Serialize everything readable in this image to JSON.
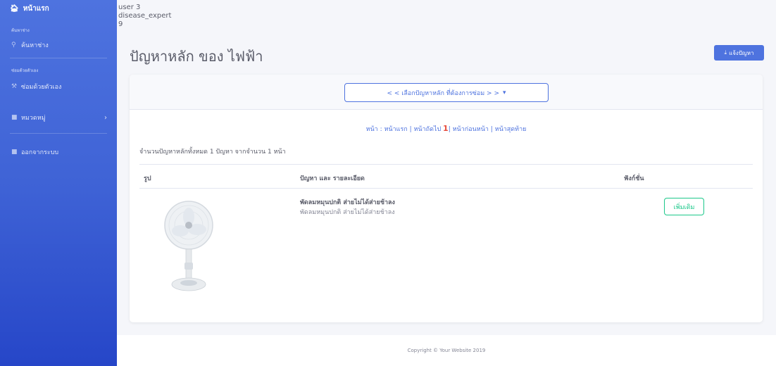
{
  "sidebar": {
    "brand": {
      "icon": "home-icon",
      "label": "หน้าแรก"
    },
    "section_search": "ค้นหาช่าง",
    "search_item": {
      "icon": "search-icon",
      "label": "ค้นหาช่าง"
    },
    "section_self_repair": "ซ่อมด้วยตัวเอง",
    "self_repair_item": {
      "icon": "wrench-icon",
      "label": "ซ่อมด้วยตัวเอง"
    },
    "category_item": {
      "icon": "folder-icon",
      "label": "หมวดหมู่",
      "chevron": "›"
    },
    "logout_item": {
      "icon": "folder-icon",
      "label": "ออกจากระบบ"
    }
  },
  "user": {
    "name": "user 3",
    "role": "disease_expert",
    "id": "9"
  },
  "page": {
    "title": "ปัญหาหลัก ของ ไฟฟ้า"
  },
  "report_button": {
    "icon": "download-icon",
    "label": "แจ้งปัญหา"
  },
  "selector": {
    "label": "< < เลือกปัญหาหลัก ที่ต้องการซ่อม > >",
    "caret": "▾"
  },
  "pager": {
    "prefix": "หน้า :",
    "first": "หน้าแรก",
    "next": "หน้าถัดไป",
    "current": "1",
    "prev": "หน้าก่อนหน้า",
    "last": "หน้าสุดท้าย"
  },
  "summary": "จำนวนปัญหาหลักทั้งหมด 1 ปัญหา จากจำนวน 1 หน้า",
  "table": {
    "headers": {
      "image": "รูป",
      "problem": "ปัญหา และ รายละเอียด",
      "function": "ฟังก์ชั่น"
    },
    "rows": [
      {
        "title": "พัดลมหมุนปกติ ส่ายไม่ได้ส่ายช้าลง",
        "description": "พัดลมหมุนปกติ ส่ายไม่ได้ส่ายช้าลง",
        "action": "เพิ่มเติม"
      }
    ]
  },
  "footer": {
    "copyright": "Copyright © Your Website 2019"
  }
}
